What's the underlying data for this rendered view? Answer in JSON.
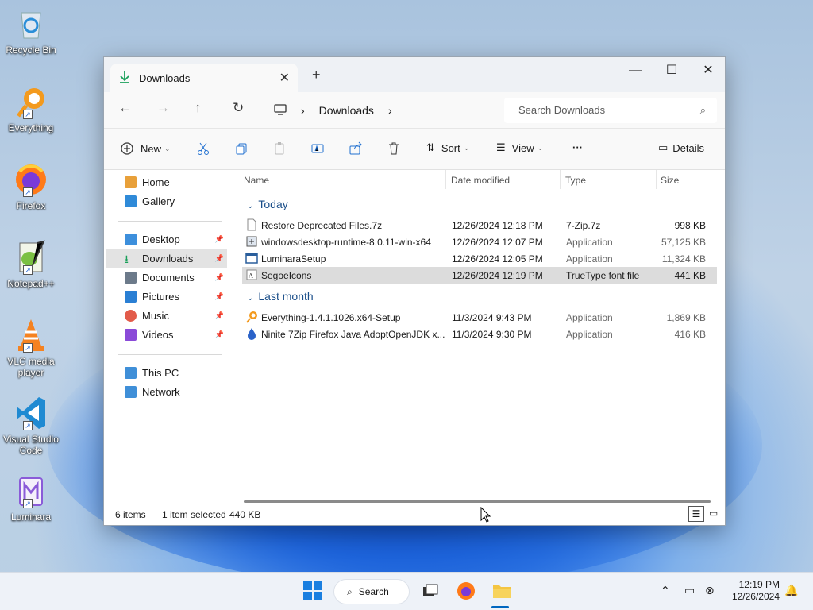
{
  "desktop": {
    "icons": [
      {
        "label": "Recycle Bin"
      },
      {
        "label": "Everything"
      },
      {
        "label": "Firefox"
      },
      {
        "label": "Notepad++"
      },
      {
        "label": "VLC media player"
      },
      {
        "label": "Visual Studio Code"
      },
      {
        "label": "Luminara"
      }
    ]
  },
  "window": {
    "tab_title": "Downloads",
    "new_tab": "+",
    "controls": {
      "minimize": "—",
      "maximize": "☐",
      "close": "✕"
    },
    "breadcrumb": [
      "Downloads"
    ],
    "search_placeholder": "Search Downloads"
  },
  "toolbar": {
    "new": "New",
    "sort": "Sort",
    "view": "View",
    "more": "···",
    "details": "Details"
  },
  "sidebar": {
    "quick": [
      {
        "label": "Home"
      },
      {
        "label": "Gallery"
      }
    ],
    "pinned": [
      {
        "label": "Desktop"
      },
      {
        "label": "Downloads"
      },
      {
        "label": "Documents"
      },
      {
        "label": "Pictures"
      },
      {
        "label": "Music"
      },
      {
        "label": "Videos"
      }
    ],
    "system": [
      {
        "label": "This PC"
      },
      {
        "label": "Network"
      }
    ]
  },
  "columns": {
    "name": "Name",
    "date": "Date modified",
    "type": "Type",
    "size": "Size"
  },
  "groups": [
    {
      "label": "Today",
      "files": [
        {
          "name": "Restore Deprecated Files.7z",
          "date": "12/26/2024 12:18 PM",
          "type": "7-Zip.7z",
          "size": "998 KB"
        },
        {
          "name": "windowsdesktop-runtime-8.0.11-win-x64",
          "date": "12/26/2024 12:07 PM",
          "type": "Application",
          "size": "57,125 KB"
        },
        {
          "name": "LuminaraSetup",
          "date": "12/26/2024 12:05 PM",
          "type": "Application",
          "size": "11,324 KB"
        },
        {
          "name": "SegoeIcons",
          "date": "12/26/2024 12:19 PM",
          "type": "TrueType font file",
          "size": "441 KB"
        }
      ]
    },
    {
      "label": "Last month",
      "files": [
        {
          "name": "Everything-1.4.1.1026.x64-Setup",
          "date": "11/3/2024 9:43 PM",
          "type": "Application",
          "size": "1,869 KB"
        },
        {
          "name": "Ninite 7Zip Firefox Java AdoptOpenJDK x...",
          "date": "11/3/2024 9:30 PM",
          "type": "Application",
          "size": "416 KB"
        }
      ]
    }
  ],
  "status": {
    "count": "6 items",
    "selection": "1 item selected",
    "size": "440 KB"
  },
  "taskbar": {
    "search": "Search",
    "time": "12:19 PM",
    "date": "12/26/2024"
  },
  "colors": {
    "accent": "#0067c0",
    "folder": "#f4c542",
    "selection": "#dcdcdc"
  }
}
